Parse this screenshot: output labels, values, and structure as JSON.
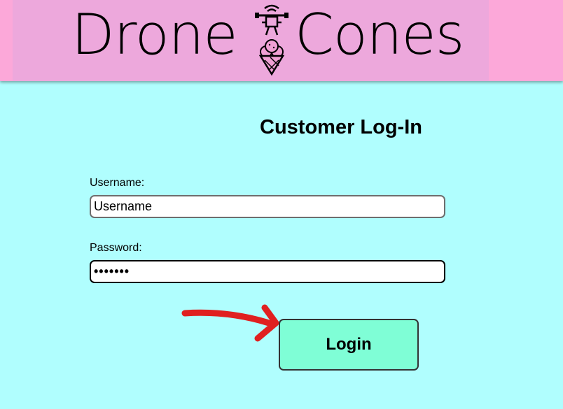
{
  "header": {
    "logo_left": "Drone",
    "logo_right": "Cones",
    "logo_icon": "drone-icecream-icon",
    "colors": {
      "header_bg": "#fca8d9",
      "banner_bg": "#eda8dc",
      "icon_pink": "#f0a0d4"
    }
  },
  "page": {
    "title": "Customer Log-In",
    "background": "#b0fefe"
  },
  "form": {
    "username_label": "Username:",
    "username_value": "Username",
    "password_label": "Password:",
    "password_value": "•••••••",
    "login_label": "Login",
    "login_color": "#7ffed6"
  },
  "annotation": {
    "arrow_icon": "red-arrow-icon",
    "arrow_color": "#e02020"
  }
}
